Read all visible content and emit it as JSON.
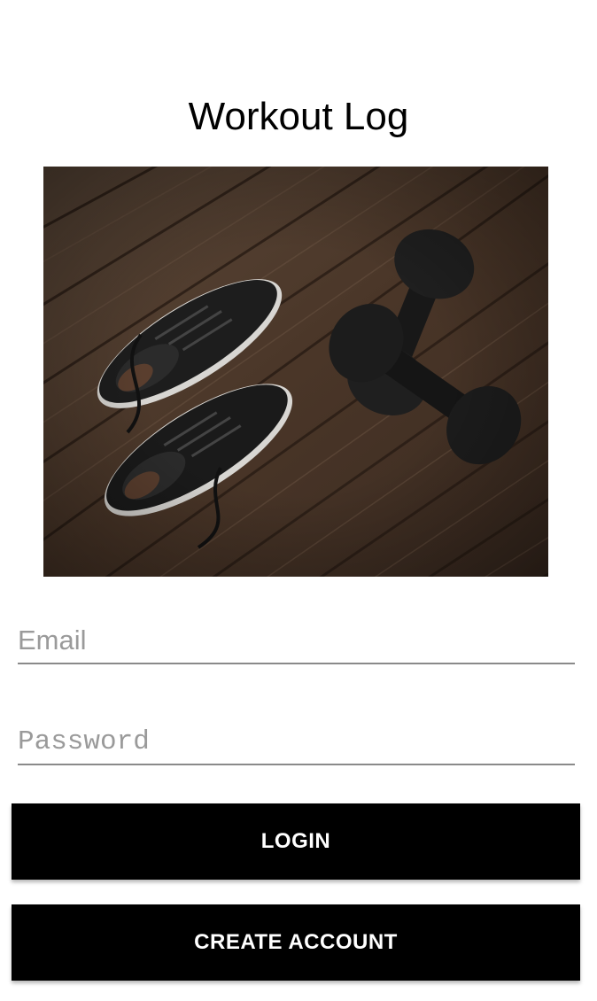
{
  "header": {
    "title": "Workout Log"
  },
  "hero": {
    "image": "sneakers-and-dumbbells-on-wood-floor"
  },
  "form": {
    "email_placeholder": "Email",
    "password_placeholder": "Password",
    "login_label": "LOGIN",
    "create_account_label": "CREATE ACCOUNT"
  },
  "colors": {
    "primary": "#000000",
    "button_text": "#ffffff",
    "underline": "#8a8a8a",
    "placeholder": "#9a9a9a"
  }
}
